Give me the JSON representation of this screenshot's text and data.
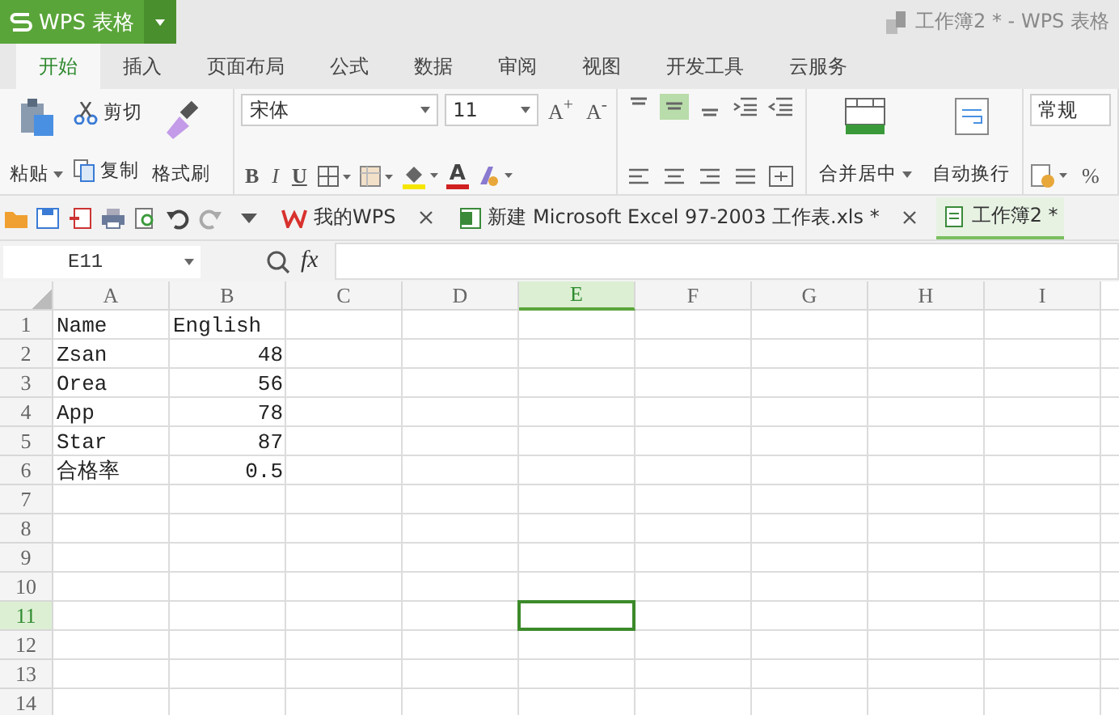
{
  "title_bar": {
    "app_name": "WPS 表格",
    "document_title": "工作簿2 * - WPS 表格"
  },
  "menu_tabs": [
    {
      "label": "开始",
      "selected": true
    },
    {
      "label": "插入",
      "selected": false
    },
    {
      "label": "页面布局",
      "selected": false
    },
    {
      "label": "公式",
      "selected": false
    },
    {
      "label": "数据",
      "selected": false
    },
    {
      "label": "审阅",
      "selected": false
    },
    {
      "label": "视图",
      "selected": false
    },
    {
      "label": "开发工具",
      "selected": false
    },
    {
      "label": "云服务",
      "selected": false
    }
  ],
  "ribbon": {
    "paste": "粘贴",
    "cut": "剪切",
    "copy": "复制",
    "format_painter": "格式刷",
    "font_name": "宋体",
    "font_size": "11",
    "grow_font": "A$^{+}$",
    "shrink_font": "A$^{-}$",
    "bold": "B",
    "italic": "I",
    "underline": "U",
    "font_color": "A",
    "merge_center": "合并居中",
    "wrap_text": "自动换行",
    "number_format": "常规",
    "percent": "%"
  },
  "doc_tabs": [
    {
      "label": "我的WPS",
      "selected": false
    },
    {
      "label": "新建 Microsoft Excel 97-2003 工作表.xls *",
      "selected": false
    },
    {
      "label": "工作簿2 *",
      "selected": true
    }
  ],
  "formula_bar": {
    "name_box": "E11",
    "fx": "fx"
  },
  "sheet": {
    "columns": [
      {
        "label": "A",
        "selected": false
      },
      {
        "label": "B",
        "selected": false
      },
      {
        "label": "C",
        "selected": false
      },
      {
        "label": "D",
        "selected": false
      },
      {
        "label": "E",
        "selected": true
      },
      {
        "label": "F",
        "selected": false
      },
      {
        "label": "G",
        "selected": false
      },
      {
        "label": "H",
        "selected": false
      },
      {
        "label": "I",
        "selected": false
      }
    ],
    "rows": [
      {
        "label": "1",
        "selected": false,
        "cells": [
          {
            "value": "Name",
            "kind": "text"
          },
          {
            "value": "English",
            "kind": "text"
          }
        ]
      },
      {
        "label": "2",
        "selected": false,
        "cells": [
          {
            "value": "Zsan",
            "kind": "text"
          },
          {
            "value": "48",
            "kind": "number"
          }
        ]
      },
      {
        "label": "3",
        "selected": false,
        "cells": [
          {
            "value": "Orea",
            "kind": "text"
          },
          {
            "value": "56",
            "kind": "number"
          }
        ]
      },
      {
        "label": "4",
        "selected": false,
        "cells": [
          {
            "value": "App",
            "kind": "text"
          },
          {
            "value": "78",
            "kind": "number"
          }
        ]
      },
      {
        "label": "5",
        "selected": false,
        "cells": [
          {
            "value": "Star",
            "kind": "text"
          },
          {
            "value": "87",
            "kind": "number"
          }
        ]
      },
      {
        "label": "6",
        "selected": false,
        "cells": [
          {
            "value": "合格率",
            "kind": "text"
          },
          {
            "value": "0.5",
            "kind": "number"
          }
        ]
      },
      {
        "label": "7",
        "selected": false,
        "cells": []
      },
      {
        "label": "8",
        "selected": false,
        "cells": []
      },
      {
        "label": "9",
        "selected": false,
        "cells": []
      },
      {
        "label": "10",
        "selected": false,
        "cells": []
      },
      {
        "label": "11",
        "selected": true,
        "cells": []
      },
      {
        "label": "12",
        "selected": false,
        "cells": []
      },
      {
        "label": "13",
        "selected": false,
        "cells": []
      },
      {
        "label": "14",
        "selected": false,
        "cells": []
      }
    ]
  }
}
